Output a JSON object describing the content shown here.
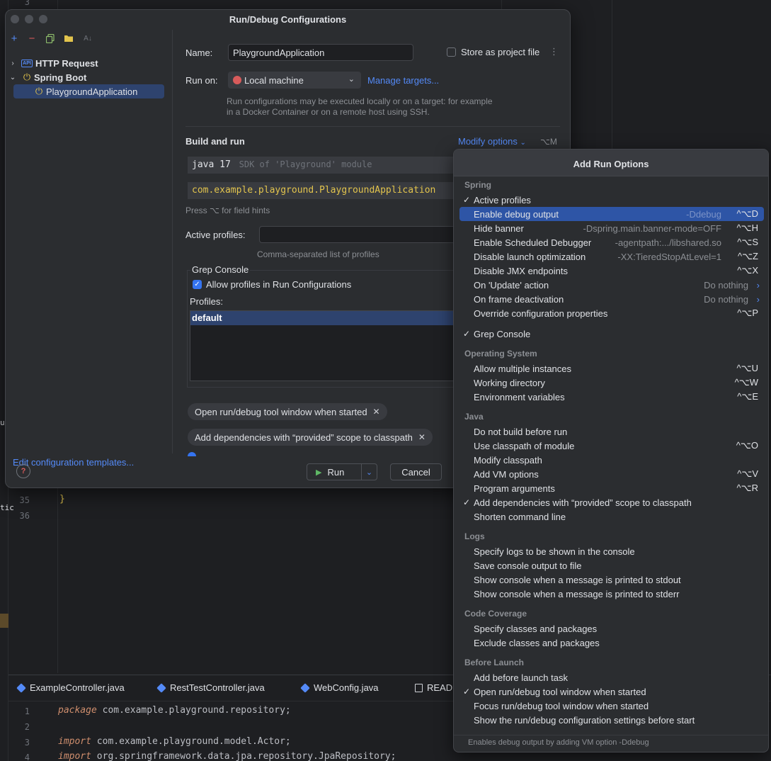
{
  "ide": {
    "line_numbers_top": [
      "3"
    ],
    "code_lines": [
      {
        "num": "35",
        "text": "}"
      },
      {
        "num": "36",
        "text": ""
      }
    ],
    "tabs": [
      {
        "label": "ExampleController.java",
        "icon": "java-class-icon"
      },
      {
        "label": "RestTestController.java",
        "icon": "java-class-icon"
      },
      {
        "label": "WebConfig.java",
        "icon": "java-class-icon"
      },
      {
        "label": "READ",
        "icon": "readme-icon"
      }
    ],
    "bottom_code": [
      {
        "num": "1",
        "kw": "package",
        "rest": " com.example.playground.repository;"
      },
      {
        "num": "2",
        "kw": "",
        "rest": ""
      },
      {
        "num": "3",
        "kw": "import",
        "rest": " com.example.playground.model.Actor;"
      },
      {
        "num": "4",
        "kw": "import",
        "rest": " org.springframework.data.jpa.repository.JpaRepository;"
      }
    ],
    "side_fragments": [
      "u",
      "tic"
    ]
  },
  "dialog": {
    "title": "Run/Debug Configurations",
    "tree": [
      {
        "label": "HTTP Request",
        "icon": "api-icon",
        "chevron": "›"
      },
      {
        "label": "Spring Boot",
        "icon": "power-icon",
        "chevron": "⌄"
      },
      {
        "label": "PlaygroundApplication",
        "icon": "power-icon",
        "selected": true
      }
    ],
    "edit_templates": "Edit configuration templates...",
    "name_label": "Name:",
    "name_value": "PlaygroundApplication",
    "store_as_project_file": "Store as project file",
    "run_on_label": "Run on:",
    "run_on_value": "Local machine",
    "manage_targets": "Manage targets...",
    "run_on_hint": "Run configurations may be executed locally or on a target: for example in a Docker Container or on a remote host using SSH.",
    "build_and_run": "Build and run",
    "modify_options": "Modify options",
    "modify_options_shortcut": "⌥M",
    "sdk_value": "java 17",
    "sdk_hint": "SDK of 'Playground' module",
    "main_class": "com.example.playground.PlaygroundApplication",
    "field_hints": "Press ⌥ for field hints",
    "active_profiles_label": "Active profiles:",
    "active_profiles_value": "",
    "active_profiles_hint": "Comma-separated list of profiles",
    "grep_console_title": "Grep Console",
    "allow_profiles": "Allow profiles in Run Configurations",
    "profiles_label": "Profiles:",
    "profiles": [
      "default"
    ],
    "chips": [
      "Open run/debug tool window when started",
      "Add dependencies with “provided” scope to classpath"
    ],
    "run_button": "Run",
    "cancel_button": "Cancel"
  },
  "popup": {
    "title": "Add Run Options",
    "footer": "Enables debug output by adding VM option -Ddebug",
    "sections": [
      {
        "title": "Spring",
        "items": [
          {
            "label": "Active profiles",
            "checked": true
          },
          {
            "label": "Enable debug output",
            "hint": "-Ddebug",
            "shortcut": "^⌥D",
            "selected": true
          },
          {
            "label": "Hide banner",
            "hint": "-Dspring.main.banner-mode=OFF",
            "shortcut": "^⌥H"
          },
          {
            "label": "Enable Scheduled Debugger",
            "hint": "-agentpath:.../libshared.so",
            "shortcut": "^⌥S"
          },
          {
            "label": "Disable launch optimization",
            "hint": "-XX:TieredStopAtLevel=1",
            "shortcut": "^⌥Z"
          },
          {
            "label": "Disable JMX endpoints",
            "shortcut": "^⌥X"
          },
          {
            "label": "On 'Update' action",
            "hint": "Do nothing",
            "arrow": true
          },
          {
            "label": "On frame deactivation",
            "hint": "Do nothing",
            "arrow": true
          },
          {
            "label": "Override configuration properties",
            "shortcut": "^⌥P"
          }
        ]
      },
      {
        "title": "",
        "items": [
          {
            "label": "Grep Console",
            "checked": true
          }
        ]
      },
      {
        "title": "Operating System",
        "items": [
          {
            "label": "Allow multiple instances",
            "shortcut": "^⌥U"
          },
          {
            "label": "Working directory",
            "shortcut": "^⌥W"
          },
          {
            "label": "Environment variables",
            "shortcut": "^⌥E"
          }
        ]
      },
      {
        "title": "Java",
        "items": [
          {
            "label": "Do not build before run"
          },
          {
            "label": "Use classpath of module",
            "shortcut": "^⌥O"
          },
          {
            "label": "Modify classpath"
          },
          {
            "label": "Add VM options",
            "shortcut": "^⌥V"
          },
          {
            "label": "Program arguments",
            "shortcut": "^⌥R"
          },
          {
            "label": "Add dependencies with “provided” scope to classpath",
            "checked": true
          },
          {
            "label": "Shorten command line"
          }
        ]
      },
      {
        "title": "Logs",
        "items": [
          {
            "label": "Specify logs to be shown in the console"
          },
          {
            "label": "Save console output to file"
          },
          {
            "label": "Show console when a message is printed to stdout"
          },
          {
            "label": "Show console when a message is printed to stderr"
          }
        ]
      },
      {
        "title": "Code Coverage",
        "items": [
          {
            "label": "Specify classes and packages"
          },
          {
            "label": "Exclude classes and packages"
          }
        ]
      },
      {
        "title": "Before Launch",
        "items": [
          {
            "label": "Add before launch task"
          },
          {
            "label": "Open run/debug tool window when started",
            "checked": true
          },
          {
            "label": "Focus run/debug tool window when started"
          },
          {
            "label": "Show the run/debug configuration settings before start"
          }
        ]
      }
    ]
  },
  "colors": {
    "background": "#1e1f22",
    "panel": "#2b2d30",
    "accent": "#548af7",
    "selection": "#2e55a6"
  }
}
